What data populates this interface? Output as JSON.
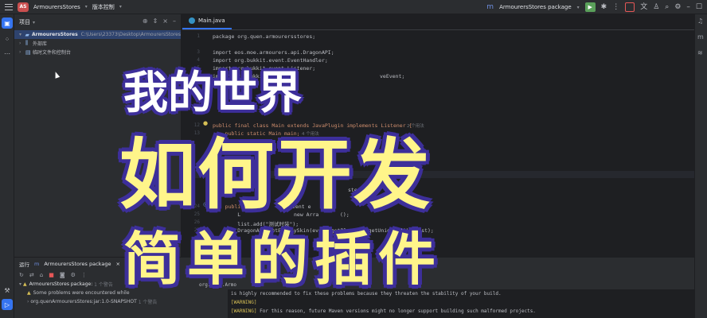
{
  "titlebar": {
    "project_badge": "AS",
    "project_name": "ArmourersStores",
    "vcs": "版本控制",
    "run_config": "ArmourersStores package"
  },
  "project_panel": {
    "title": "项目",
    "tree": [
      {
        "name": "ArmourersStores",
        "path": "C:\\Users\\23373\\Desktop\\ArmourersStores"
      },
      {
        "name": "外部库",
        "path": ""
      },
      {
        "name": "临时文件和控制台",
        "path": ""
      }
    ]
  },
  "editor": {
    "tab": "Main.java",
    "lines": [
      {
        "n": "1",
        "text": "package org.quen.armourersstores;"
      },
      {
        "n": "3",
        "text": "import eos.moe.armourers.api.DragonAPI;"
      },
      {
        "n": "4",
        "text": "import org.bukkit.event.EventHandler;"
      },
      {
        "n": "5",
        "text": "import org.bukkit.event.Listener;"
      },
      {
        "n": "6",
        "text": "import org.bukkit.ev"
      },
      {
        "n": "12",
        "text": "public final class Main extends JavaPlugin implements Listener {"
      },
      {
        "n": "13",
        "text": "    public static Main main;"
      },
      {
        "n": "24",
        "text": "    public"
      },
      {
        "n": "25",
        "text": "        L"
      },
      {
        "n": "26",
        "text": "        list.add(\"测试时装\");"
      },
      {
        "n": "27",
        "text": "        DragonAPI.setEntitySkin(event.getPlayer().getUniqueId(), list);"
      },
      {
        "n": "28",
        "text": "    }"
      }
    ],
    "fragments": {
      "l6_tail": "veEvent;",
      "l12_hint": "2 个用法",
      "l13_hint": "4 个用法",
      "l20_tail": "sterEv",
      "l24_tail": "vent e",
      "l25_tail": "new Arra",
      "l25_end": "();"
    }
  },
  "run_panel": {
    "title": "运行",
    "config": "ArmourersStores package",
    "rows": [
      {
        "label": "ArmourersStores package:",
        "note": "1 个警告"
      },
      {
        "label": "Some problems were encountered while"
      },
      {
        "label": "org.quenArmourersStores:jar:1.0-SNAPSHOT",
        "note": "1 个警告"
      }
    ],
    "console": [
      {
        "pre": "",
        "text": "org.quen.Armo"
      },
      {
        "pre": "",
        "text": "is highly recommended to fix these problems because they threaten the stability of your build."
      },
      {
        "pre": "[WARNING]",
        "text": ""
      },
      {
        "pre": "[WARNING]",
        "text": "For this reason, future Maven versions might no longer support building such malformed projects."
      }
    ]
  },
  "overlay": {
    "line1": "我的世界",
    "line2": "如何开发",
    "line3": "简单的插件"
  },
  "colors": {
    "accent": "#3574f0",
    "overlay_fill_yellow": "#fff58a",
    "overlay_outline": "#3d2f9a"
  }
}
